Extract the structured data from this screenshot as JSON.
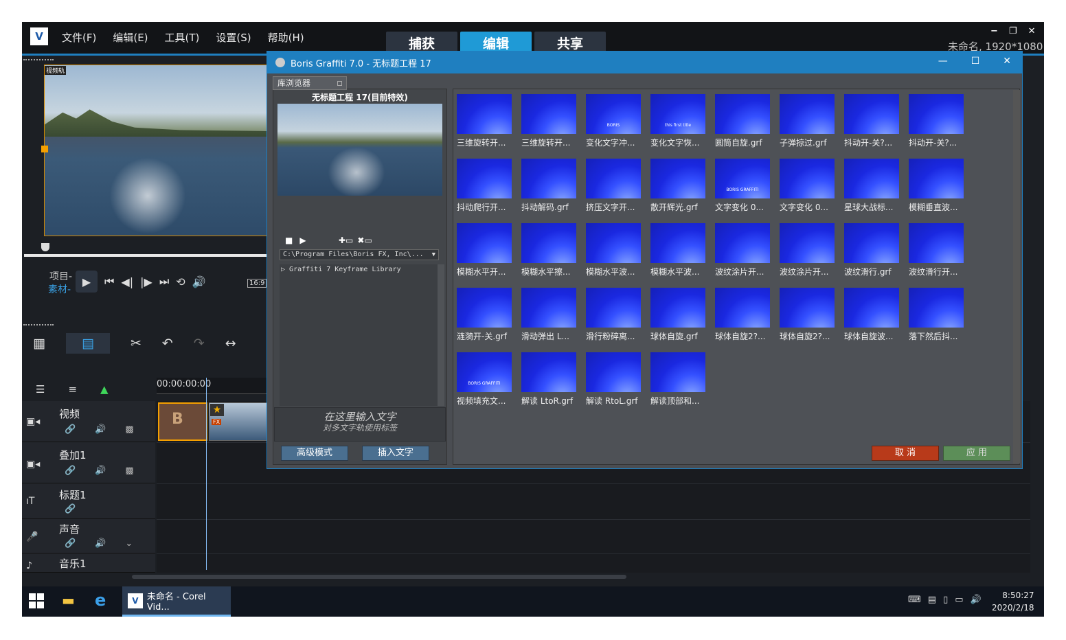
{
  "app": {
    "logo": "V",
    "menus": [
      "文件(F)",
      "编辑(E)",
      "工具(T)",
      "设置(S)",
      "帮助(H)"
    ],
    "mode_tabs": [
      "捕获",
      "编辑",
      "共享"
    ],
    "active_tab": "编辑",
    "project_info": "未命名, 1920*1080",
    "window_controls": [
      "−",
      "❐",
      "✕"
    ]
  },
  "preview": {
    "track_label": "视频轨",
    "project_label": "项目-",
    "clip_label": "素材-",
    "aspect_ratio": "16:9"
  },
  "timeline": {
    "timecode": "00:00:00:00",
    "tracks": [
      {
        "name": "视频",
        "icon": "video-track-icon"
      },
      {
        "name": "叠加1",
        "icon": "overlay-track-icon"
      },
      {
        "name": "标题1",
        "icon": "title-track-icon"
      },
      {
        "name": "声音",
        "icon": "voice-track-icon"
      },
      {
        "name": "音乐1",
        "icon": "music-track-icon"
      }
    ],
    "fx_tag": "FX",
    "clip_letter": "B"
  },
  "dialog": {
    "title": "Boris Graffiti 7.0 - 无标题工程 17",
    "library_tab": "库浏览器",
    "preview_title": "无标题工程 17(目前特效)",
    "path": "C:\\Program Files\\Boris FX, Inc\\...",
    "tree_item": "Graffiti 7 Keyframe Library",
    "text_hint_main": "在这里输入文字",
    "text_hint_sub": "对多文字轨使用标签",
    "btn_advanced": "高级模式",
    "btn_insert": "插入文字",
    "btn_cancel": "取 消",
    "btn_apply": "应 用",
    "presets": [
      {
        "label": "三维旋转开...",
        "thumb_text": ""
      },
      {
        "label": "三维旋转开...",
        "thumb_text": ""
      },
      {
        "label": "变化文字冲...",
        "thumb_text": "BORIS"
      },
      {
        "label": "变化文字恢...",
        "thumb_text": "this first title"
      },
      {
        "label": "圆筒自旋.grf",
        "thumb_text": ""
      },
      {
        "label": "子弹掠过.grf",
        "thumb_text": ""
      },
      {
        "label": "抖动开-关?...",
        "thumb_text": ""
      },
      {
        "label": "抖动开-关?...",
        "thumb_text": ""
      },
      {
        "label": "抖动爬行开...",
        "thumb_text": ""
      },
      {
        "label": "抖动解码.grf",
        "thumb_text": ""
      },
      {
        "label": "挤压文字开...",
        "thumb_text": ""
      },
      {
        "label": "散开辉光.grf",
        "thumb_text": ""
      },
      {
        "label": "文字变化 0...",
        "thumb_text": "BORIS GRAFFITI"
      },
      {
        "label": "文字变化 0...",
        "thumb_text": ""
      },
      {
        "label": "星球大战标...",
        "thumb_text": ""
      },
      {
        "label": "模糊垂直波...",
        "thumb_text": ""
      },
      {
        "label": "模糊水平开...",
        "thumb_text": ""
      },
      {
        "label": "模糊水平擦...",
        "thumb_text": ""
      },
      {
        "label": "模糊水平波...",
        "thumb_text": ""
      },
      {
        "label": "模糊水平波...",
        "thumb_text": ""
      },
      {
        "label": "波纹涂片开...",
        "thumb_text": ""
      },
      {
        "label": "波纹涂片开...",
        "thumb_text": ""
      },
      {
        "label": "波纹滑行.grf",
        "thumb_text": ""
      },
      {
        "label": "波纹滑行开...",
        "thumb_text": ""
      },
      {
        "label": "涟漪开-关.grf",
        "thumb_text": ""
      },
      {
        "label": "滑动弹出 L...",
        "thumb_text": ""
      },
      {
        "label": "滑行粉碎离...",
        "thumb_text": ""
      },
      {
        "label": "球体自旋.grf",
        "thumb_text": ""
      },
      {
        "label": "球体自旋2?...",
        "thumb_text": ""
      },
      {
        "label": "球体自旋2?...",
        "thumb_text": ""
      },
      {
        "label": "球体自旋波...",
        "thumb_text": ""
      },
      {
        "label": "落下然后抖...",
        "thumb_text": ""
      },
      {
        "label": "视频填充文...",
        "thumb_text": "BORIS GRAFFITI"
      },
      {
        "label": "解读 LtoR.grf",
        "thumb_text": ""
      },
      {
        "label": "解读 RtoL.grf",
        "thumb_text": ""
      },
      {
        "label": "解读顶部和...",
        "thumb_text": ""
      }
    ]
  },
  "taskbar": {
    "task_label": "未命名 - Corel Vid...",
    "task_icon": "V",
    "time": "8:50:27",
    "date": "2020/2/18"
  }
}
